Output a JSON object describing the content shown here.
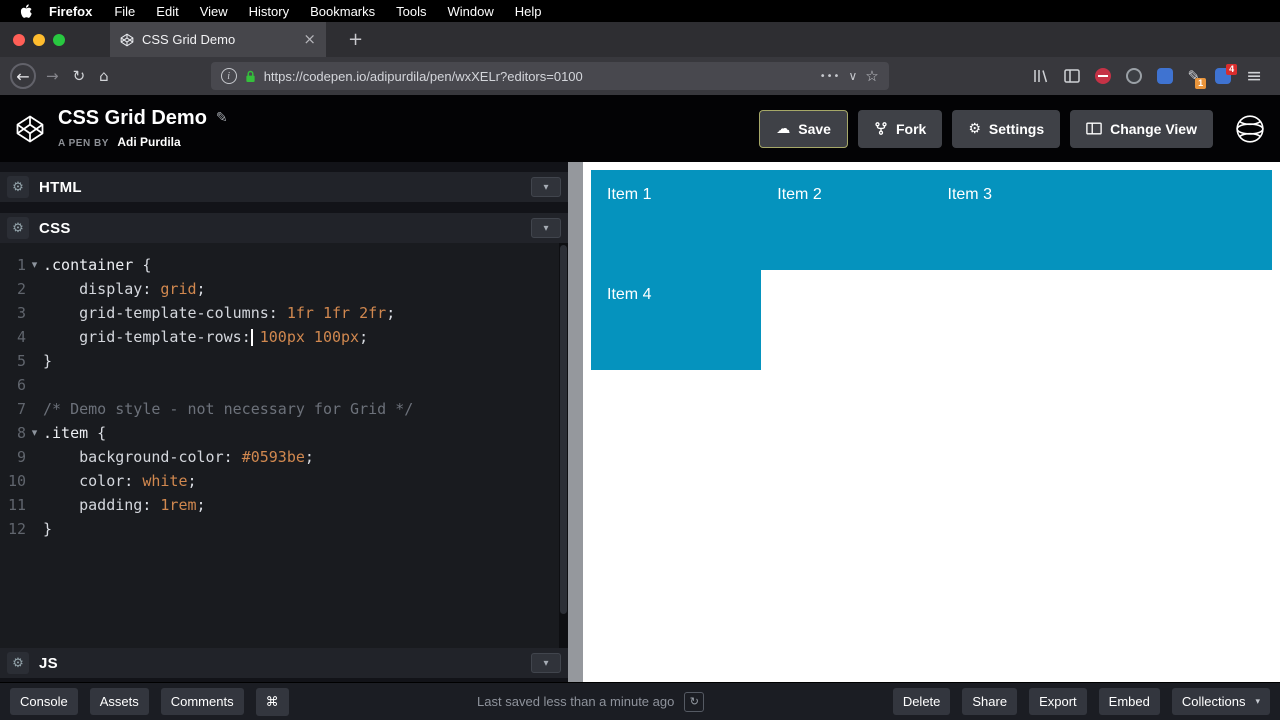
{
  "icons": {
    "fold": "▾",
    "chevron_down": "▾",
    "gear": "⚙",
    "close": "×",
    "plus": "+",
    "back": "←",
    "forward": "→",
    "reload": "↻",
    "home": "⌂",
    "info_letter": "i",
    "dots": "•••",
    "pocket": "∨",
    "star": "☆",
    "pencil": "✎",
    "cloud": "☁",
    "command": "⌘",
    "rerun": "↻",
    "menu": "≡"
  },
  "menubar": {
    "app_name": "Firefox",
    "items": [
      "File",
      "Edit",
      "View",
      "History",
      "Bookmarks",
      "Tools",
      "Window",
      "Help"
    ]
  },
  "tab_bar": {
    "active_tab_title": "CSS Grid Demo"
  },
  "toolbar": {
    "url": "https://codepen.io/adipurdila/pen/wxXELr?editors=0100",
    "compose_badge": "1",
    "app_badge": "4"
  },
  "pen_header": {
    "title": "CSS Grid Demo",
    "byline_label": "A PEN BY",
    "author": "Adi Purdila",
    "save_label": "Save",
    "fork_label": "Fork",
    "settings_label": "Settings",
    "change_view_label": "Change View"
  },
  "editor": {
    "html_label": "HTML",
    "css_label": "CSS",
    "js_label": "JS",
    "css_lines": [
      {
        "n": "1",
        "fold": true,
        "tokens": [
          [
            "sel",
            ".container"
          ],
          [
            "plain",
            " {"
          ]
        ]
      },
      {
        "n": "2",
        "tokens": [
          [
            "plain",
            "    "
          ],
          [
            "prop",
            "display"
          ],
          [
            "plain",
            ": "
          ],
          [
            "val",
            "grid"
          ],
          [
            "plain",
            ";"
          ]
        ]
      },
      {
        "n": "3",
        "tokens": [
          [
            "plain",
            "    "
          ],
          [
            "prop",
            "grid-template-columns"
          ],
          [
            "plain",
            ": "
          ],
          [
            "val",
            "1fr 1fr 2fr"
          ],
          [
            "plain",
            ";"
          ]
        ]
      },
      {
        "n": "4",
        "tokens": [
          [
            "plain",
            "    "
          ],
          [
            "prop",
            "grid-template-rows"
          ],
          [
            "plain",
            ":"
          ],
          [
            "cursor",
            ""
          ],
          [
            "plain",
            " "
          ],
          [
            "val",
            "100px 100px"
          ],
          [
            "plain",
            ";"
          ]
        ]
      },
      {
        "n": "5",
        "tokens": [
          [
            "plain",
            "}"
          ]
        ]
      },
      {
        "n": "6",
        "tokens": []
      },
      {
        "n": "7",
        "tokens": [
          [
            "comment",
            "/* Demo style - not necessary for Grid */"
          ]
        ]
      },
      {
        "n": "8",
        "fold": true,
        "tokens": [
          [
            "sel",
            ".item"
          ],
          [
            "plain",
            " {"
          ]
        ]
      },
      {
        "n": "9",
        "tokens": [
          [
            "plain",
            "    "
          ],
          [
            "prop",
            "background-color"
          ],
          [
            "plain",
            ": "
          ],
          [
            "val",
            "#0593be"
          ],
          [
            "plain",
            ";"
          ]
        ]
      },
      {
        "n": "10",
        "tokens": [
          [
            "plain",
            "    "
          ],
          [
            "prop",
            "color"
          ],
          [
            "plain",
            ": "
          ],
          [
            "val",
            "white"
          ],
          [
            "plain",
            ";"
          ]
        ]
      },
      {
        "n": "11",
        "tokens": [
          [
            "plain",
            "    "
          ],
          [
            "prop",
            "padding"
          ],
          [
            "plain",
            ": "
          ],
          [
            "val",
            "1rem"
          ],
          [
            "plain",
            ";"
          ]
        ]
      },
      {
        "n": "12",
        "tokens": [
          [
            "plain",
            "}"
          ]
        ]
      }
    ]
  },
  "preview": {
    "item_color": "#0593be",
    "items": [
      {
        "label": "Item 1"
      },
      {
        "label": "Item 2"
      },
      {
        "label": "Item 3"
      },
      {
        "label": "Item 4"
      }
    ]
  },
  "footer": {
    "left_buttons": [
      "Console",
      "Assets",
      "Comments"
    ],
    "status": "Last saved less than a minute ago",
    "right_buttons": [
      "Delete",
      "Share",
      "Export",
      "Embed",
      "Collections"
    ]
  }
}
